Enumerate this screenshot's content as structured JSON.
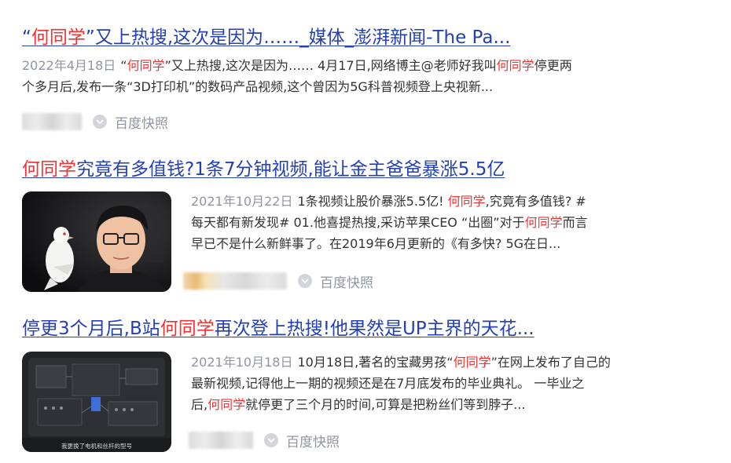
{
  "results": [
    {
      "title_parts": [
        "“",
        "何同学",
        "”又上热搜,这次是因为……_媒体_澎湃新闻-The Pa..."
      ],
      "date": "2022年4月18日",
      "abstract_line1": [
        "“",
        "何同学",
        "”又上热搜,这次是因为…… 4月17日,网络博主@老师好我叫",
        "何同学",
        "停更两"
      ],
      "abstract_line2": "个多月后,发布一条“3D打印机”的数码产品视频,这个曾因为5G科普视频登上央视新...",
      "snapshot_label": "百度快照"
    },
    {
      "title_parts": [
        "何同学",
        "究竟有多值钱?1条7分钟视频,能让金主爸爸暴涨5.5亿"
      ],
      "date": "2021年10月22日",
      "abstract_line1": [
        "1条视频让股价暴涨5.5亿! ",
        "何同学",
        ",究竟有多值钱? #"
      ],
      "abstract_line2": [
        "每天都有新发现# 01.他喜提热搜,采访苹果CEO “出圈”对于",
        "何同学",
        "而言"
      ],
      "abstract_line3": "早已不是什么新鲜事了。在2019年6月更新的《有多快? 5G在日...",
      "thumbnail": "man-with-white-pigeon-photo",
      "snapshot_label": "百度快照"
    },
    {
      "title_parts": [
        "停更3个月后,B站",
        "何同学",
        "再次登上热搜!他果然是UP主界的天花..."
      ],
      "date": "2021年10月18日",
      "abstract_line1": [
        "10月18日,著名的宝藏男孩“",
        "何同学",
        "”在网上发布了自己的"
      ],
      "abstract_line2": "最新视频,记得他上一期的视频还是在7月底发布的毕业典礼。 一毕业之",
      "abstract_line3": [
        "后,",
        "何同学",
        "就停更了三个月的时间,可算是把粉丝们等到脖子..."
      ],
      "thumbnail": "circuit-board-video-frame",
      "thumbnail_caption": "我更换了电机和丝杆的型号",
      "snapshot_label": "百度快照"
    }
  ],
  "colors": {
    "link": "#2440b3",
    "highlight": "#f73131",
    "meta": "#9195a3"
  }
}
